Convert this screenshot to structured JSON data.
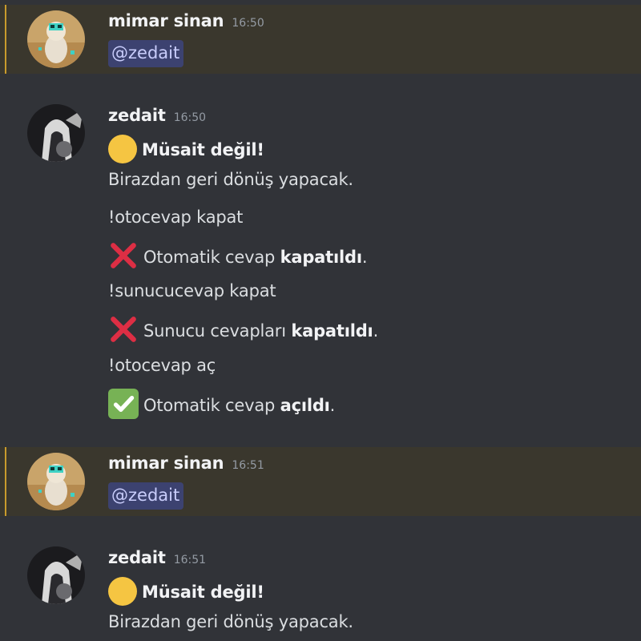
{
  "colors": {
    "background": "#313338",
    "mention_highlight": "#3a372d",
    "mention_bar": "#c99b2c",
    "mention_pill_bg": "#3c4270",
    "mention_pill_text": "#c9cdfb",
    "status_dot": "#f5c542",
    "cross": "#dd2e44",
    "check_bg": "#77b255"
  },
  "messages": [
    {
      "author": "mimar sinan",
      "timestamp": "16:50",
      "avatar_icon": "cat-avatar-icon",
      "mention": "@zedait"
    },
    {
      "author": "zedait",
      "timestamp": "16:50",
      "avatar_icon": "anime-avatar-icon",
      "status_icon": "yellow-circle-icon",
      "status_title": "Müsait değil!",
      "status_desc": "Birazdan geri dönüş yapacak.",
      "cmd1": "!otocevap kapat",
      "res1_icon": "cross-mark-icon",
      "res1_text": "Otomatik cevap ",
      "res1_bold": "kapatıldı",
      "res1_end": ".",
      "cmd2": "!sunucucevap kapat",
      "res2_icon": "cross-mark-icon",
      "res2_text": "Sunucu cevapları ",
      "res2_bold": "kapatıldı",
      "res2_end": ".",
      "cmd3": "!otocevap aç",
      "res3_icon": "check-mark-icon",
      "res3_text": "Otomatik cevap ",
      "res3_bold": "açıldı",
      "res3_end": "."
    },
    {
      "author": "mimar sinan",
      "timestamp": "16:51",
      "avatar_icon": "cat-avatar-icon",
      "mention": "@zedait"
    },
    {
      "author": "zedait",
      "timestamp": "16:51",
      "avatar_icon": "anime-avatar-icon",
      "status_icon": "yellow-circle-icon",
      "status_title": "Müsait değil!",
      "status_desc": "Birazdan geri dönüş yapacak."
    }
  ]
}
